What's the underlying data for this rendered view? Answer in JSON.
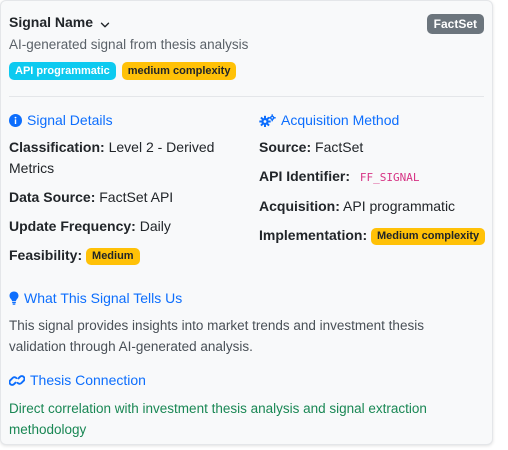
{
  "header": {
    "title": "Signal Name",
    "subtitle": "AI-generated signal from thesis analysis",
    "source_badge": "FactSet",
    "badges": [
      "API programmatic",
      "medium complexity"
    ]
  },
  "signal_details": {
    "heading": "Signal Details",
    "classification_label": "Classification:",
    "classification_value": "Level 2 - Derived",
    "classification_value_2": "Metrics",
    "data_source_label": "Data Source:",
    "data_source_value": "FactSet API",
    "update_frequency_label": "Update Frequency:",
    "update_frequency_value": "Daily",
    "feasibility_label": "Feasibility:",
    "feasibility_value": "Medium"
  },
  "acquisition": {
    "heading": "Acquisition Method",
    "source_label": "Source:",
    "source_value": "FactSet",
    "api_identifier_label": "API Identifier:",
    "api_identifier_value": "FF_SIGNAL",
    "acquisition_label": "Acquisition:",
    "acquisition_value": "API programmatic",
    "implementation_label": "Implementation:",
    "implementation_value": "Medium complexity"
  },
  "tells_us": {
    "heading": "What This Signal Tells Us",
    "text": "This signal provides insights into market trends and investment thesis validation through AI-generated analysis."
  },
  "thesis": {
    "heading": "Thesis Connection",
    "text": "Direct correlation with investment thesis analysis and signal extraction methodology"
  },
  "colors": {
    "accent": "#0d6efd",
    "info_badge": "#0dcaf0",
    "warning_badge": "#ffc107",
    "secondary_badge": "#6c757d",
    "success_text": "#198754",
    "code_text": "#d63384"
  },
  "icons": [
    "chevron-down-icon",
    "info-circle-icon",
    "gears-icon",
    "lightbulb-icon",
    "link-icon"
  ]
}
